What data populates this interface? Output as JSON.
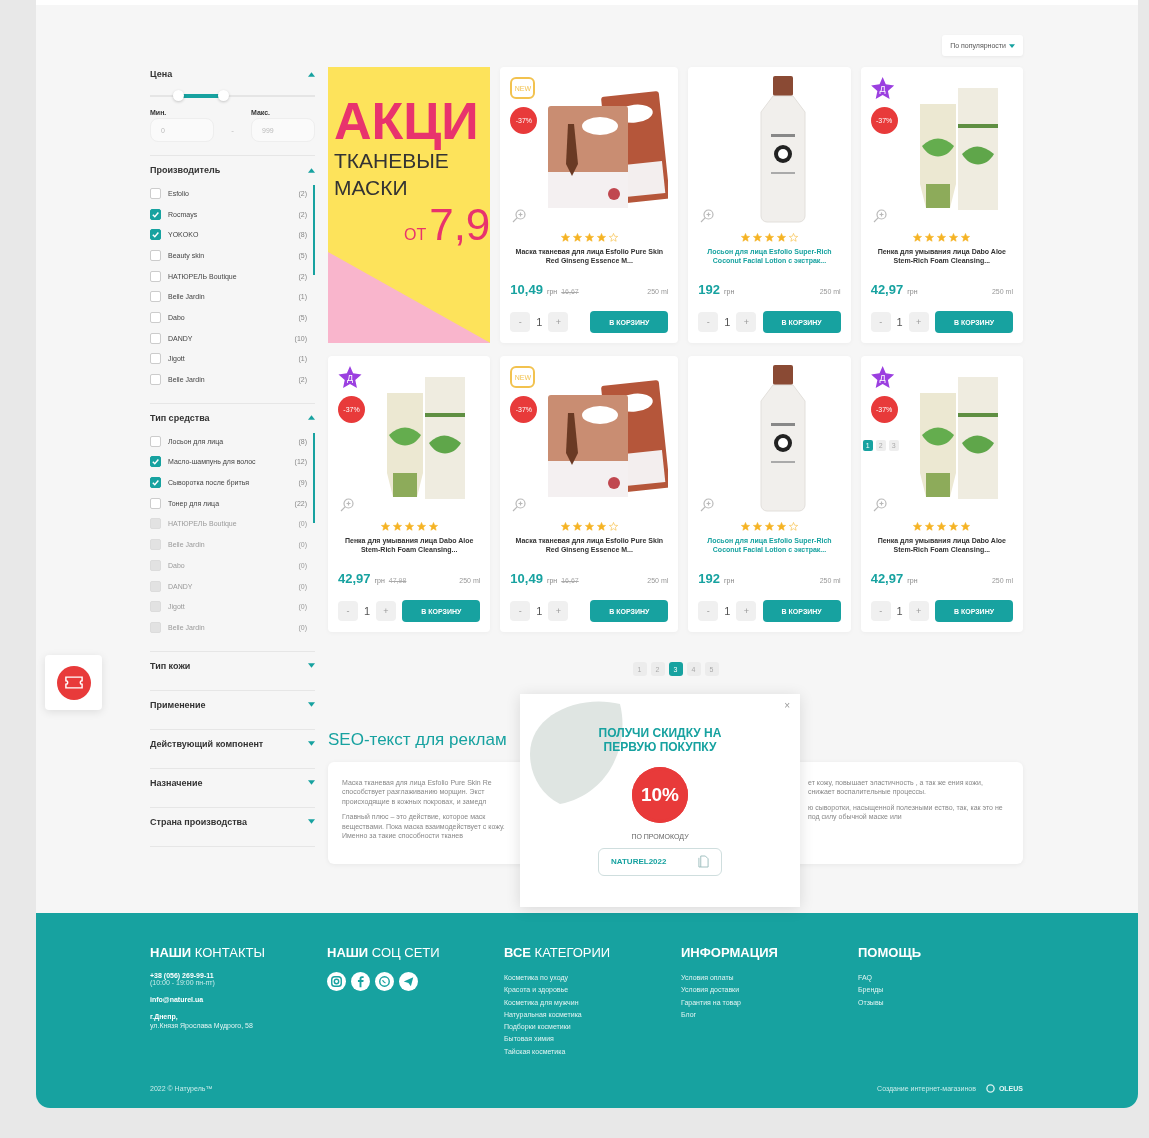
{
  "sort": {
    "label": "По популярности"
  },
  "filters": [
    {
      "title": "Цена",
      "kind": "price",
      "expanded": true,
      "min_label": "Мин.",
      "max_label": "Макс.",
      "min_placeholder": "0",
      "max_placeholder": "999",
      "dash": "-",
      "thumbs": [
        {
          "level": 0.17
        },
        {
          "level": 0.44
        }
      ]
    },
    {
      "title": "Производитель",
      "kind": "checklist",
      "expanded": true,
      "options": [
        {
          "label": "Esfolio",
          "count": "(2)",
          "checked": false,
          "disabled": false
        },
        {
          "label": "Rocmays",
          "count": "(2)",
          "checked": true,
          "disabled": false
        },
        {
          "label": "YOKOKO",
          "count": "(8)",
          "checked": true,
          "disabled": false
        },
        {
          "label": "Beauty skin",
          "count": "(5)",
          "checked": false,
          "disabled": false
        },
        {
          "label": "НАТЮРЕЛЬ Boutique",
          "count": "(2)",
          "checked": false,
          "disabled": false
        },
        {
          "label": "Belle Jardin",
          "count": "(1)",
          "checked": false,
          "disabled": false
        },
        {
          "label": "Dabo",
          "count": "(5)",
          "checked": false,
          "disabled": false
        },
        {
          "label": "DANDY",
          "count": "(10)",
          "checked": false,
          "disabled": false
        },
        {
          "label": "Jigott",
          "count": "(1)",
          "checked": false,
          "disabled": false
        },
        {
          "label": "Belle Jardin",
          "count": "(2)",
          "checked": false,
          "disabled": false
        }
      ]
    },
    {
      "title": "Тип средства",
      "kind": "checklist",
      "expanded": true,
      "options": [
        {
          "label": "Лосьон для лица",
          "count": "(8)",
          "checked": false,
          "disabled": false
        },
        {
          "label": "Масло-шампунь для волос",
          "count": "(12)",
          "checked": true,
          "disabled": false
        },
        {
          "label": "Сыворотка после бритья",
          "count": "(9)",
          "checked": true,
          "disabled": false
        },
        {
          "label": "Тонер для лица",
          "count": "(22)",
          "checked": false,
          "disabled": false
        },
        {
          "label": "НАТЮРЕЛЬ Boutique",
          "count": "(0)",
          "checked": false,
          "disabled": true
        },
        {
          "label": "Belle Jardin",
          "count": "(0)",
          "checked": false,
          "disabled": true
        },
        {
          "label": "Dabo",
          "count": "(0)",
          "checked": false,
          "disabled": true
        },
        {
          "label": "DANDY",
          "count": "(0)",
          "checked": false,
          "disabled": true
        },
        {
          "label": "Jigott",
          "count": "(0)",
          "checked": false,
          "disabled": true
        },
        {
          "label": "Belle Jardin",
          "count": "(0)",
          "checked": false,
          "disabled": true
        }
      ]
    },
    {
      "title": "Тип кожи",
      "expanded": false
    },
    {
      "title": "Применение",
      "expanded": false
    },
    {
      "title": "Действующий компонент",
      "expanded": false
    },
    {
      "title": "Назначение",
      "expanded": false
    },
    {
      "title": "Страна производства",
      "expanded": false
    }
  ],
  "banner": {
    "headline": "АКЦИ",
    "subtitle_1": "ТКАНЕВЫЕ",
    "subtitle_2": "МАСКИ",
    "from": "ОТ",
    "price": "7,9"
  },
  "products": [
    {
      "kind": "mask",
      "badge": {
        "kind": "new",
        "text": "NEW"
      },
      "discount": "-37%",
      "stars": 4,
      "name": "Маска тканевая для лица Esfolio Pure Skin Red Ginseng Essence M...",
      "highlighted": false,
      "price": "10,49",
      "currency": "грн",
      "old_price": "16,67",
      "volume": "250 ml",
      "qty": "1",
      "minus": "-",
      "plus": "+",
      "button": "В КОРЗИНУ"
    },
    {
      "kind": "bottle",
      "stars": 4,
      "name": "Лосьон для лица Esfolio Super-Rich Coconut Facial Lotion с экстрак...",
      "highlighted": true,
      "price": "192",
      "currency": "грн",
      "volume": "250 ml",
      "qty": "1",
      "minus": "-",
      "plus": "+",
      "button": "В КОРЗИНУ"
    },
    {
      "kind": "tube",
      "badge": {
        "kind": "star",
        "text": "Д"
      },
      "discount": "-37%",
      "stars": 5,
      "name": "Пенка для умывания лица Dabo Aloe Stem-Rich Foam Cleansing...",
      "highlighted": false,
      "price": "42,97",
      "currency": "грн",
      "volume": "250 ml",
      "qty": "1",
      "minus": "-",
      "plus": "+",
      "button": "В КОРЗИНУ"
    },
    {
      "kind": "tube",
      "badge": {
        "kind": "star",
        "text": "Д"
      },
      "discount": "-37%",
      "stars": 5,
      "name": "Пенка для умывания лица Dabo Aloe Stem-Rich Foam Cleansing...",
      "highlighted": false,
      "price": "42,97",
      "currency": "грн",
      "old_price": "47,98",
      "volume": "250 ml",
      "qty": "1",
      "minus": "-",
      "plus": "+",
      "button": "В КОРЗИНУ"
    },
    {
      "kind": "mask",
      "badge": {
        "kind": "new",
        "text": "NEW"
      },
      "discount": "-37%",
      "stars": 4,
      "name": "Маска тканевая для лица Esfolio Pure Skin Red Ginseng Essence M...",
      "highlighted": false,
      "price": "10,49",
      "currency": "грн",
      "old_price": "16,67",
      "volume": "250 ml",
      "qty": "1",
      "minus": "-",
      "plus": "+",
      "button": "В КОРЗИНУ"
    },
    {
      "kind": "bottle",
      "stars": 4,
      "name": "Лосьон для лица Esfolio Super-Rich Coconut Facial Lotion с экстрак...",
      "highlighted": true,
      "price": "192",
      "currency": "грн",
      "volume": "250 ml",
      "qty": "1",
      "minus": "-",
      "plus": "+",
      "button": "В КОРЗИНУ"
    },
    {
      "kind": "tube",
      "badge": {
        "kind": "star",
        "text": "Д"
      },
      "discount": "-37%",
      "stars": 5,
      "name": "Пенка для умывания лица Dabo Aloe Stem-Rich Foam Cleansing...",
      "highlighted": false,
      "price": "42,97",
      "currency": "грн",
      "volume": "250 ml",
      "qty": "1",
      "minus": "-",
      "plus": "+",
      "button": "В КОРЗИНУ",
      "image_pages": [
        {
          "label": "1",
          "selected": true
        },
        {
          "label": "2",
          "selected": false
        },
        {
          "label": "3",
          "selected": false
        }
      ]
    }
  ],
  "pagination": [
    {
      "label": "1",
      "selected": false
    },
    {
      "label": "2",
      "selected": false
    },
    {
      "label": "3",
      "selected": true
    },
    {
      "label": "4",
      "selected": false
    },
    {
      "label": "5",
      "selected": false
    }
  ],
  "seo": {
    "title": "SEO-текст для реклам",
    "left_paragraphs": [
      "Маска тканевая для лица Esfolio Pure Skin Re способствует разглаживанию морщин. Экст происходящие в кожных покровах, и замедл",
      "Главный плюс – это действие, которое маск веществами. Пока маска взаимодействует с кожу. Именно за такие способности тканев"
    ],
    "right_paragraphs": [
      "ет кожу, повышает эластичность , а так же ения кожи, снижает воспалительные процессы.",
      "ю сыворотки, насыщенной полезными ество, так, как это не под силу обычной маске или"
    ]
  },
  "popup": {
    "close": "×",
    "title": "ПОЛУЧИ СКИДКУ НА ПЕРВУЮ ПОКУПКУ",
    "discount": "10%",
    "caption": "ПО ПРОМОКОДУ",
    "code": "NATUREL2022"
  },
  "footer": {
    "columns": [
      {
        "kind": "contacts",
        "title": "**НАШИ** КОНТАКТЫ",
        "phone": "+38 (056) 269-99-11",
        "hours": "(10:00 - 19:00 пн-пт)",
        "email": "info@naturel.ua",
        "city": "г.Днепр,",
        "address": "ул.Князя Ярослава Мудрого, 58"
      },
      {
        "kind": "social",
        "title": "**НАШИ** СОЦ СЕТИ"
      },
      {
        "kind": "links",
        "title": "**ВСЕ** КАТЕГОРИИ",
        "links": [
          "Косметика по уходу",
          "Красота и здоровье",
          "Косметика для мужчин",
          "Натуральная косметика",
          "Подборки косметики",
          "Бытовая химия",
          "Тайская косметика"
        ]
      },
      {
        "kind": "links",
        "title": "**ИНФОРМАЦИЯ**",
        "links": [
          "Условия оплаты",
          "Условия доставки",
          "Гарантия на товар",
          "Блог"
        ]
      },
      {
        "kind": "links",
        "title": "**ПОМОЩЬ**",
        "links": [
          "FAQ",
          "Бренды",
          "Отзывы"
        ]
      }
    ],
    "copyright": "2022 © Натурель™",
    "credit": "Создание интернет-магазинов",
    "studio": "OLEUS"
  }
}
